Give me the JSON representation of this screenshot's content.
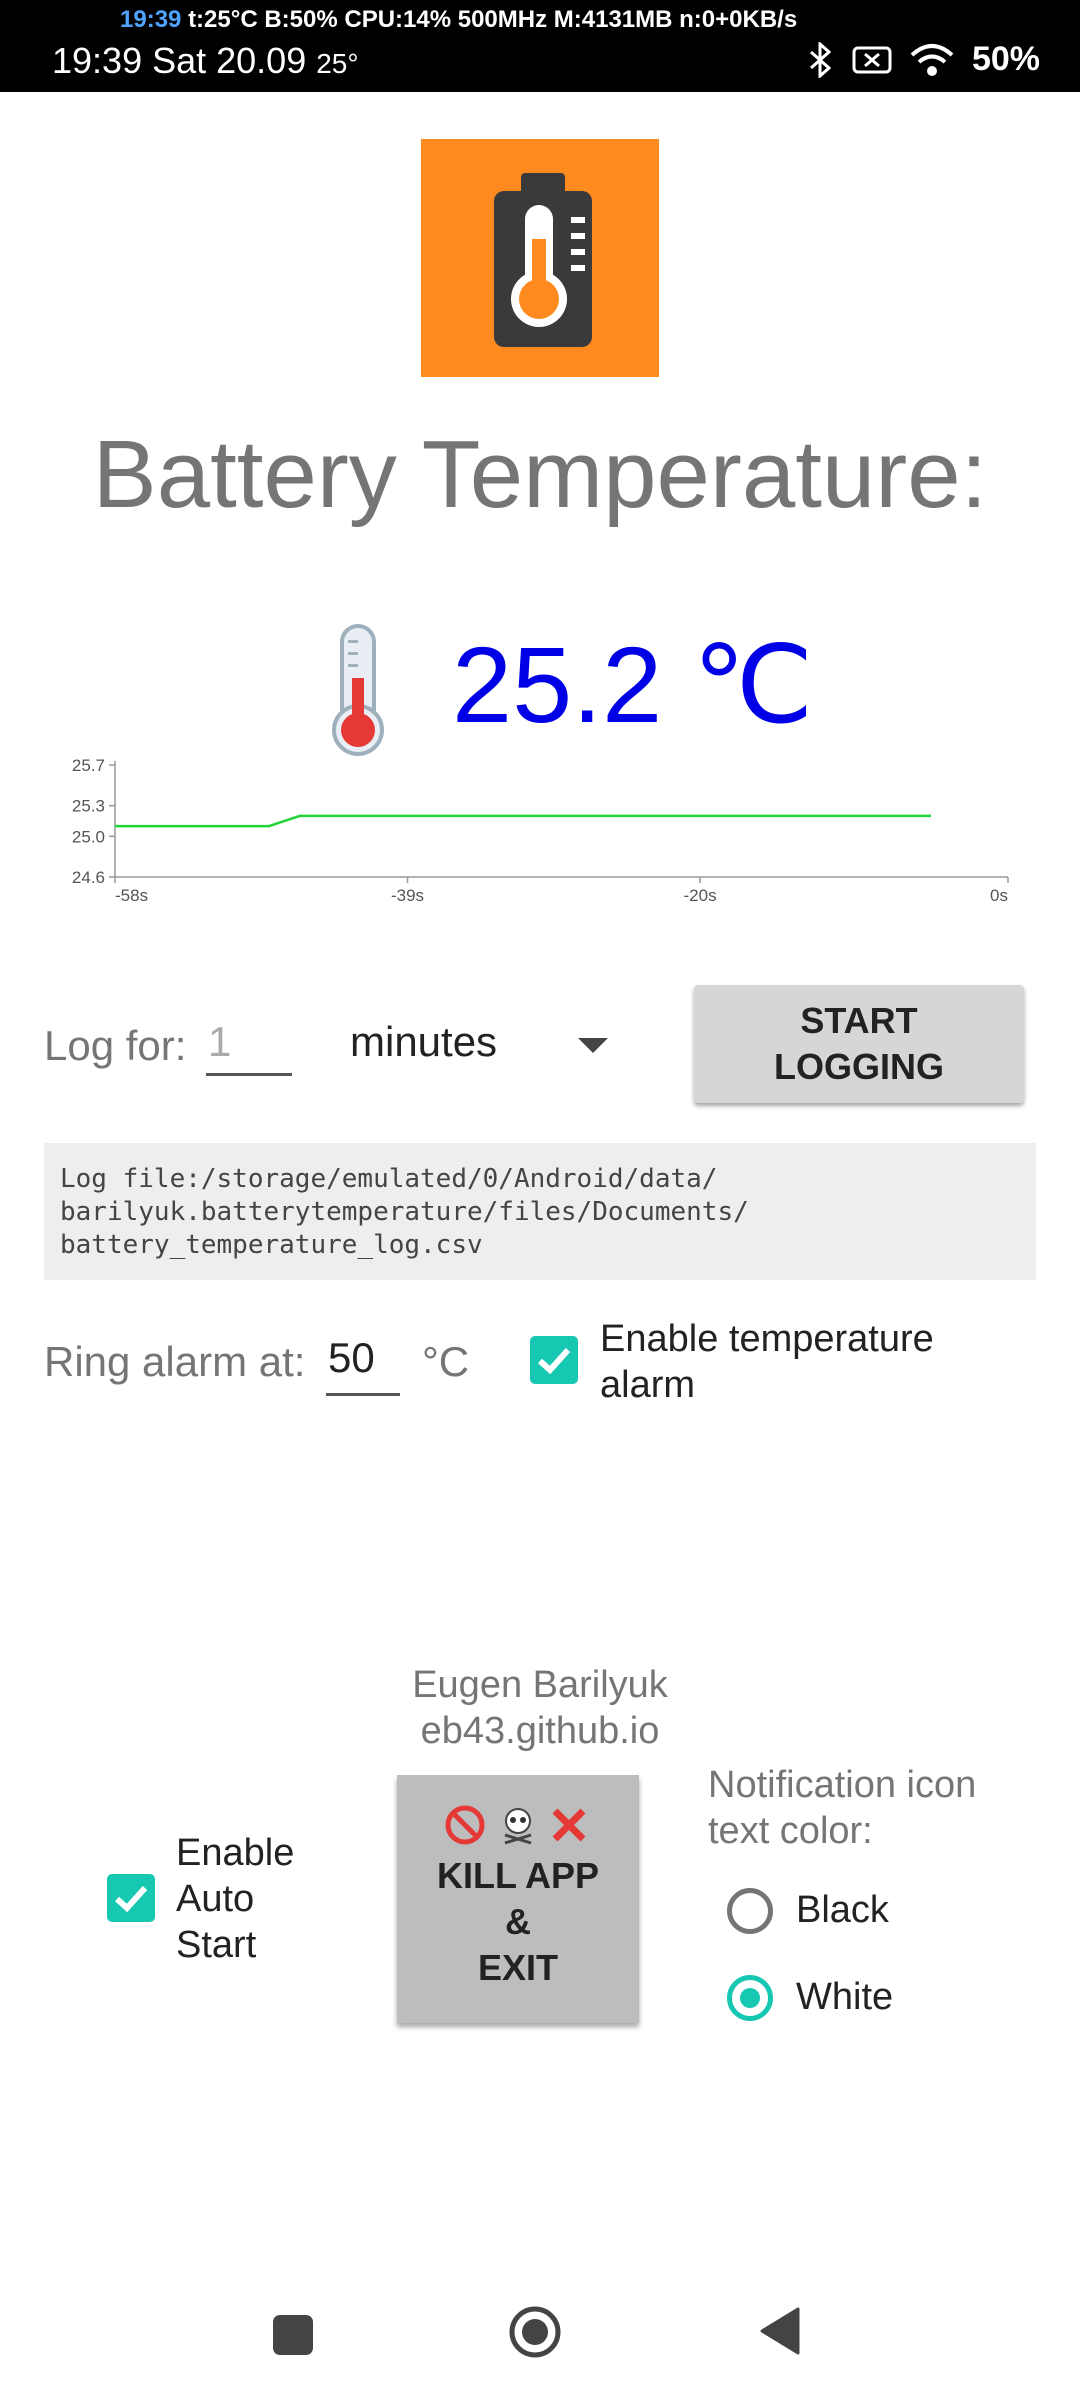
{
  "status_bar": {
    "top_time": "19:39",
    "stats": "t:25°C B:50% CPU:14% 500MHz M:4131MB n:0+0KB/s",
    "clock": "19:39 Sat 20.09",
    "temp_badge": "25°",
    "battery": "50%"
  },
  "title": "Battery Temperature:",
  "temperature": "25.2 ℃",
  "chart_data": {
    "type": "line",
    "x": [
      -58,
      -48,
      -46,
      -5
    ],
    "y": [
      25.1,
      25.1,
      25.2,
      25.2
    ],
    "xlim": [
      -58,
      0
    ],
    "ylim": [
      24.6,
      25.7
    ],
    "x_tick_labels": [
      "-58s",
      "-39s",
      "-20s",
      "0s"
    ],
    "x_ticks": [
      -58,
      -39,
      -20,
      0
    ],
    "y_tick_labels": [
      "25.7",
      "25.3",
      "25.0",
      "24.6"
    ],
    "y_ticks": [
      25.7,
      25.3,
      25.0,
      24.6
    ],
    "line_color": "#22d43a",
    "grid": false
  },
  "logging": {
    "label": "Log for:",
    "duration_value": "1",
    "unit": "minutes",
    "start_button": "START\nLOGGING",
    "log_file_text": "Log file:/storage/emulated/0/Android/data/\nbarilyuk.batterytemperature/files/Documents/\nbattery_temperature_log.csv"
  },
  "alarm": {
    "label": "Ring alarm at:",
    "value": "50",
    "unit": "°C",
    "enable_label": "Enable temperature alarm",
    "enabled": true
  },
  "footer": {
    "author": "Eugen Barilyuk",
    "website": "eb43.github.io",
    "autostart_label": "Enable Auto Start",
    "autostart_enabled": true,
    "kill_icons": "🚫☠️❌",
    "kill_button": "KILL APP\n&\nEXIT",
    "notif_label": "Notification icon text color:",
    "radio_options": [
      "Black",
      "White"
    ],
    "selected": "White"
  },
  "colors": {
    "accent": "#16c7b2",
    "temp_value": "#0000e6",
    "icon_bg": "#ff8a1f"
  },
  "nav": {
    "icons": [
      "recents-icon",
      "home-icon",
      "back-icon"
    ]
  }
}
